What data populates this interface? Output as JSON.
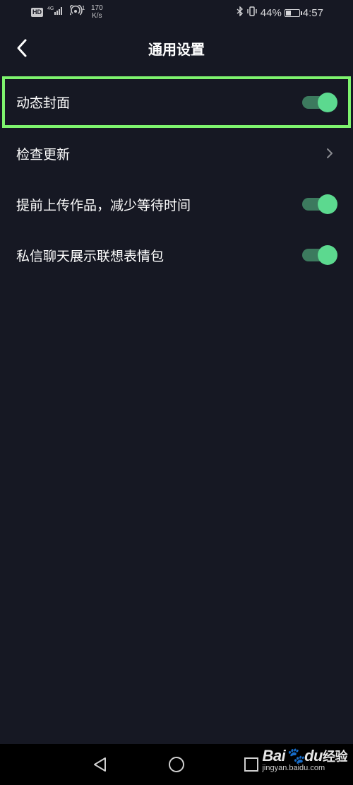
{
  "status_bar": {
    "hd": "HD",
    "net_top": "4G",
    "hotspot_count": "1",
    "speed_value": "170",
    "speed_unit": "K/s",
    "battery_percent": "44%",
    "battery_level": 0.44,
    "time": "4:57"
  },
  "header": {
    "title": "通用设置"
  },
  "settings": [
    {
      "label": "动态封面",
      "control": "toggle",
      "on": true,
      "highlighted": true
    },
    {
      "label": "检查更新",
      "control": "chevron"
    },
    {
      "label": "提前上传作品，减少等待时间",
      "control": "toggle",
      "on": true
    },
    {
      "label": "私信聊天展示联想表情包",
      "control": "toggle",
      "on": true
    }
  ],
  "watermark": {
    "brand": "Bai",
    "brand2": "du",
    "suffix": "经验",
    "url": "jingyan.baidu.com"
  },
  "colors": {
    "background": "#161823",
    "toggle_track": "#3c7a5e",
    "toggle_knob": "#5cd98f",
    "highlight_border": "#7ef46e"
  },
  "icons": {
    "back": "chevron-left-icon",
    "row_arrow": "chevron-right-icon",
    "sys_back": "triangle-back-icon",
    "sys_home": "circle-home-icon",
    "sys_recent": "square-recent-icon"
  }
}
